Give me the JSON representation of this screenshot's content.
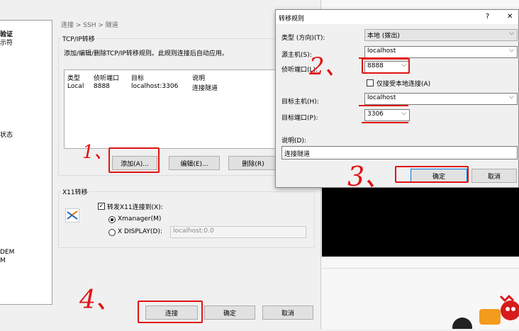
{
  "sidebar": {
    "items": [
      "验证",
      "示符",
      "状态",
      "DEM",
      "M"
    ]
  },
  "breadcrumb": "连接 > SSH > 隧道",
  "tcp": {
    "title": "TCP/IP转移",
    "desc": "添加/编辑/删除TCP/IP转移规则。此规则连接后自动应用。",
    "columns": [
      "类型",
      "侦听端口",
      "目标",
      "说明"
    ],
    "rows": [
      [
        "Local",
        "8888",
        "localhost:3306",
        "连接隧道"
      ]
    ],
    "add_label": "添加(A)...",
    "edit_label": "编辑(E)...",
    "delete_label": "删除(R)"
  },
  "x11": {
    "title": "X11转移",
    "forward_label": "转发X11连接到(X):",
    "opt_xmanager": "Xmanager(M)",
    "opt_display": "X DISPLAY(D):",
    "display_value": "localhost:0.0"
  },
  "footer": {
    "connect": "连接",
    "ok": "确定",
    "cancel": "取消"
  },
  "dialog": {
    "title": "转移规则",
    "help": "?",
    "close": "✕",
    "type_label": "类型 (方向)(T):",
    "type_value": "本地 (拨出)",
    "src_host_label": "源主机(S):",
    "src_host_value": "localhost",
    "listen_port_label": "侦听端口(L):",
    "listen_port_value": "8888",
    "local_only_label": "仅接受本地连接(A)",
    "dst_host_label": "目标主机(H):",
    "dst_host_value": "localhost",
    "dst_port_label": "目标端口(P):",
    "dst_port_value": "3306",
    "desc_label": "说明(D):",
    "desc_value": "连接隧道",
    "ok": "确定",
    "cancel": "取消"
  },
  "annotations": {
    "n1": "1、",
    "n2": "2、",
    "n3": "3、",
    "n4": "4、"
  },
  "colors": {
    "highlight": "#e21414",
    "terminal": "#000000"
  }
}
